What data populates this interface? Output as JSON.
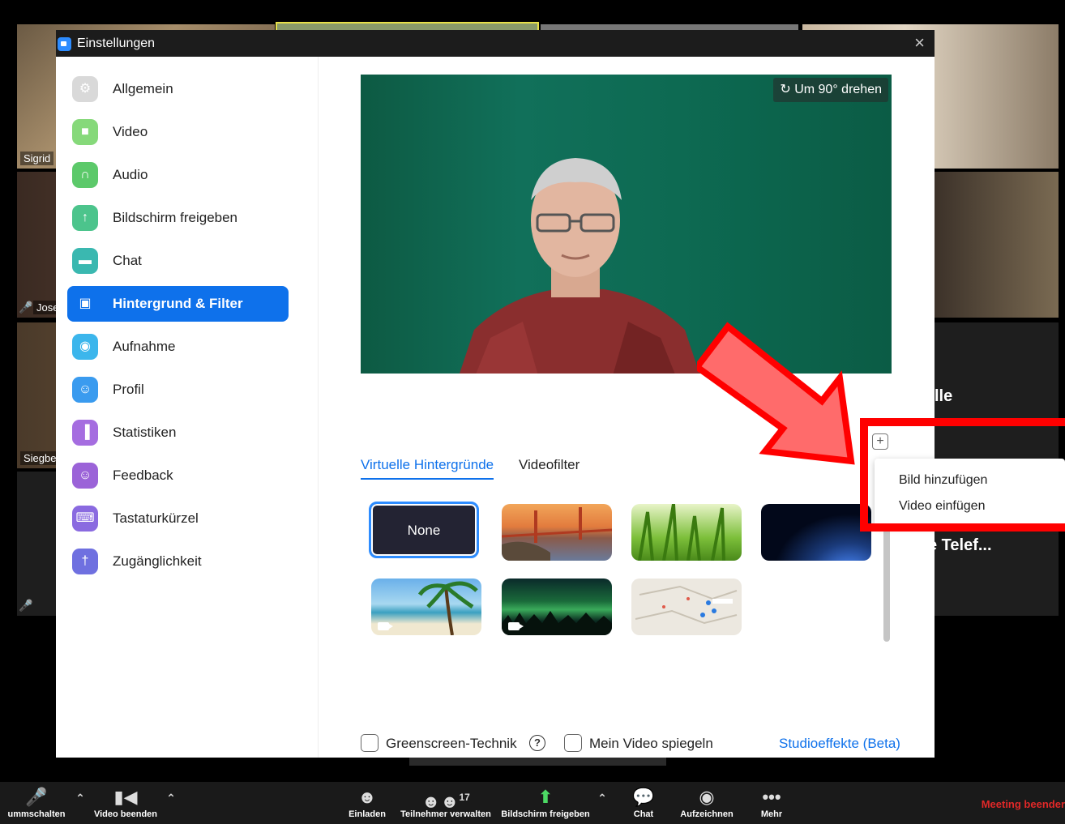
{
  "gallery": {
    "tiles": [
      {
        "name": "Sigrid"
      },
      {
        "name": "Jose"
      },
      {
        "name": "Siegbe"
      }
    ],
    "right_labels": [
      "lle",
      "e Telef..."
    ]
  },
  "toolbar": {
    "items": [
      {
        "label": "ummschalten"
      },
      {
        "label": "Video beenden"
      },
      {
        "label": "Einladen"
      },
      {
        "label": "Teilnehmer verwalten",
        "count": "17"
      },
      {
        "label": "Bildschirm freigeben"
      },
      {
        "label": "Chat"
      },
      {
        "label": "Aufzeichnen"
      },
      {
        "label": "Mehr"
      }
    ],
    "end_meeting": "Meeting beender"
  },
  "dialog": {
    "title": "Einstellungen",
    "sidebar": {
      "items": [
        {
          "label": "Allgemein",
          "icon": "gear-icon",
          "color": "#d9d9d9"
        },
        {
          "label": "Video",
          "icon": "video-icon",
          "color": "#86d97a"
        },
        {
          "label": "Audio",
          "icon": "headphones-icon",
          "color": "#5cc96a"
        },
        {
          "label": "Bildschirm freigeben",
          "icon": "share-screen-icon",
          "color": "#4cc48c"
        },
        {
          "label": "Chat",
          "icon": "chat-icon",
          "color": "#3ab8b0"
        },
        {
          "label": "Hintergrund & Filter",
          "icon": "background-icon",
          "color": "#0e71eb",
          "active": true
        },
        {
          "label": "Aufnahme",
          "icon": "record-icon",
          "color": "#3cb6ec"
        },
        {
          "label": "Profil",
          "icon": "profile-icon",
          "color": "#3a9bef"
        },
        {
          "label": "Statistiken",
          "icon": "statistics-icon",
          "color": "#a56de0"
        },
        {
          "label": "Feedback",
          "icon": "feedback-icon",
          "color": "#9b63d8"
        },
        {
          "label": "Tastaturkürzel",
          "icon": "keyboard-icon",
          "color": "#8a6ae0"
        },
        {
          "label": "Zugänglichkeit",
          "icon": "accessibility-icon",
          "color": "#6f70e0"
        }
      ]
    },
    "content": {
      "rotate_label": "Um 90° drehen",
      "tabs": [
        "Virtuelle Hintergründe",
        "Videofilter"
      ],
      "thumbnails": [
        {
          "label": "None"
        },
        {
          "label": ""
        },
        {
          "label": ""
        },
        {
          "label": ""
        },
        {
          "label": ""
        },
        {
          "label": ""
        },
        {
          "label": ""
        }
      ],
      "options": {
        "greenscreen_label": "Greenscreen-Technik",
        "greenscreen_checked": false,
        "mirror_label": "Mein Video spiegeln",
        "mirror_checked": false,
        "studio_link": "Studioeffekte (Beta)"
      }
    },
    "popup_menu": {
      "items": [
        "Bild hinzufügen",
        "Video einfügen"
      ]
    }
  },
  "colors": {
    "accent": "#0e71eb",
    "annotation": "#ff0000",
    "end_meeting": "#e02828"
  }
}
